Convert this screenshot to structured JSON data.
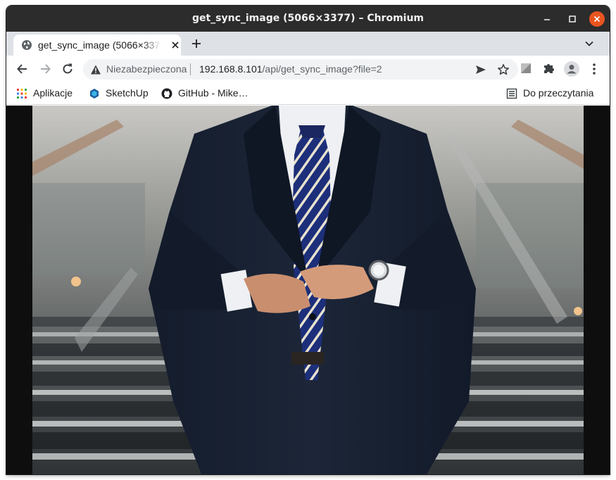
{
  "window": {
    "title": "get_sync_image (5066×3377) – Chromium"
  },
  "tabs": [
    {
      "title": "get_sync_image (5066×3377) – Chromium",
      "favicon": "globe-icon",
      "active": true
    }
  ],
  "toolbar": {
    "security_label": "Niezabezpieczona",
    "url_host": "192.168.8.101",
    "url_path": "/api/get_sync_image?file=2"
  },
  "bookmarks": [
    {
      "label": "Aplikacje",
      "icon": "apps-grid-icon"
    },
    {
      "label": "SketchUp",
      "icon": "sketchup-icon"
    },
    {
      "label": "GitHub - Mike…",
      "icon": "github-icon"
    }
  ],
  "reading_list": {
    "label": "Do przeczytania",
    "icon": "reading-list-icon"
  },
  "content": {
    "image_description": "",
    "colors": {
      "background": "#0e0e0e",
      "accent_close": "#e95420",
      "titlebar": "#2c2c2c"
    }
  }
}
